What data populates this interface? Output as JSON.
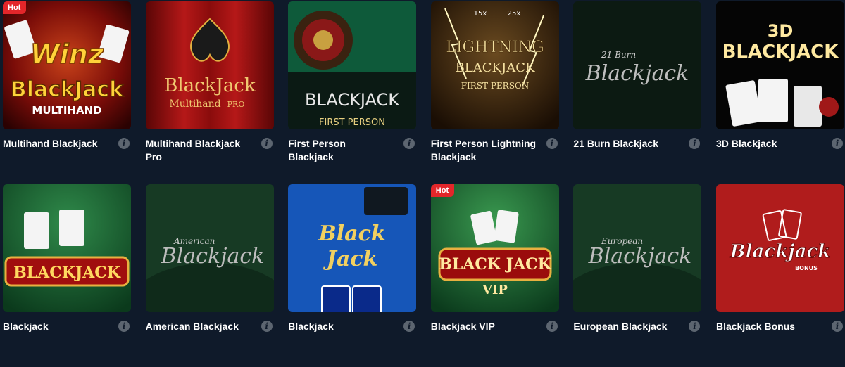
{
  "games": [
    {
      "title": "Multihand Blackjack",
      "badge": "Hot",
      "art": [
        "Winz",
        "BlackJack",
        "MULTIHAND"
      ]
    },
    {
      "title": "Multihand Blackjack Pro",
      "badge": "",
      "art": [
        "BlackJack",
        "Multihand",
        "PRO"
      ]
    },
    {
      "title": "First Person Blackjack",
      "badge": "",
      "art": [
        "BLACKJACK",
        "FIRST PERSON"
      ]
    },
    {
      "title": "First Person Lightning Blackjack",
      "badge": "",
      "art": [
        "LIGHTNING",
        "BLACKJACK",
        "FIRST PERSON",
        "15x",
        "25x"
      ]
    },
    {
      "title": "21 Burn Blackjack",
      "badge": "",
      "art": [
        "21 Burn",
        "Blackjack"
      ]
    },
    {
      "title": "3D Blackjack",
      "badge": "",
      "art": [
        "3D",
        "BLACKJACK"
      ]
    },
    {
      "title": "Blackjack",
      "badge": "",
      "art": [
        "BLACKJACK"
      ]
    },
    {
      "title": "American Blackjack",
      "badge": "",
      "art": [
        "American",
        "Blackjack"
      ]
    },
    {
      "title": "Blackjack",
      "badge": "",
      "art": [
        "Black",
        "Jack"
      ]
    },
    {
      "title": "Blackjack VIP",
      "badge": "Hot",
      "art": [
        "BLACK",
        "JACK",
        "VIP"
      ]
    },
    {
      "title": "European Blackjack",
      "badge": "",
      "art": [
        "European",
        "Blackjack"
      ]
    },
    {
      "title": "Blackjack Bonus",
      "badge": "",
      "art": [
        "Blackjack",
        "BONUS"
      ]
    }
  ],
  "info_glyph": "i",
  "colors": {
    "background": "#0f1a2a",
    "badge": "#e3262a",
    "info": "#5c6570"
  }
}
